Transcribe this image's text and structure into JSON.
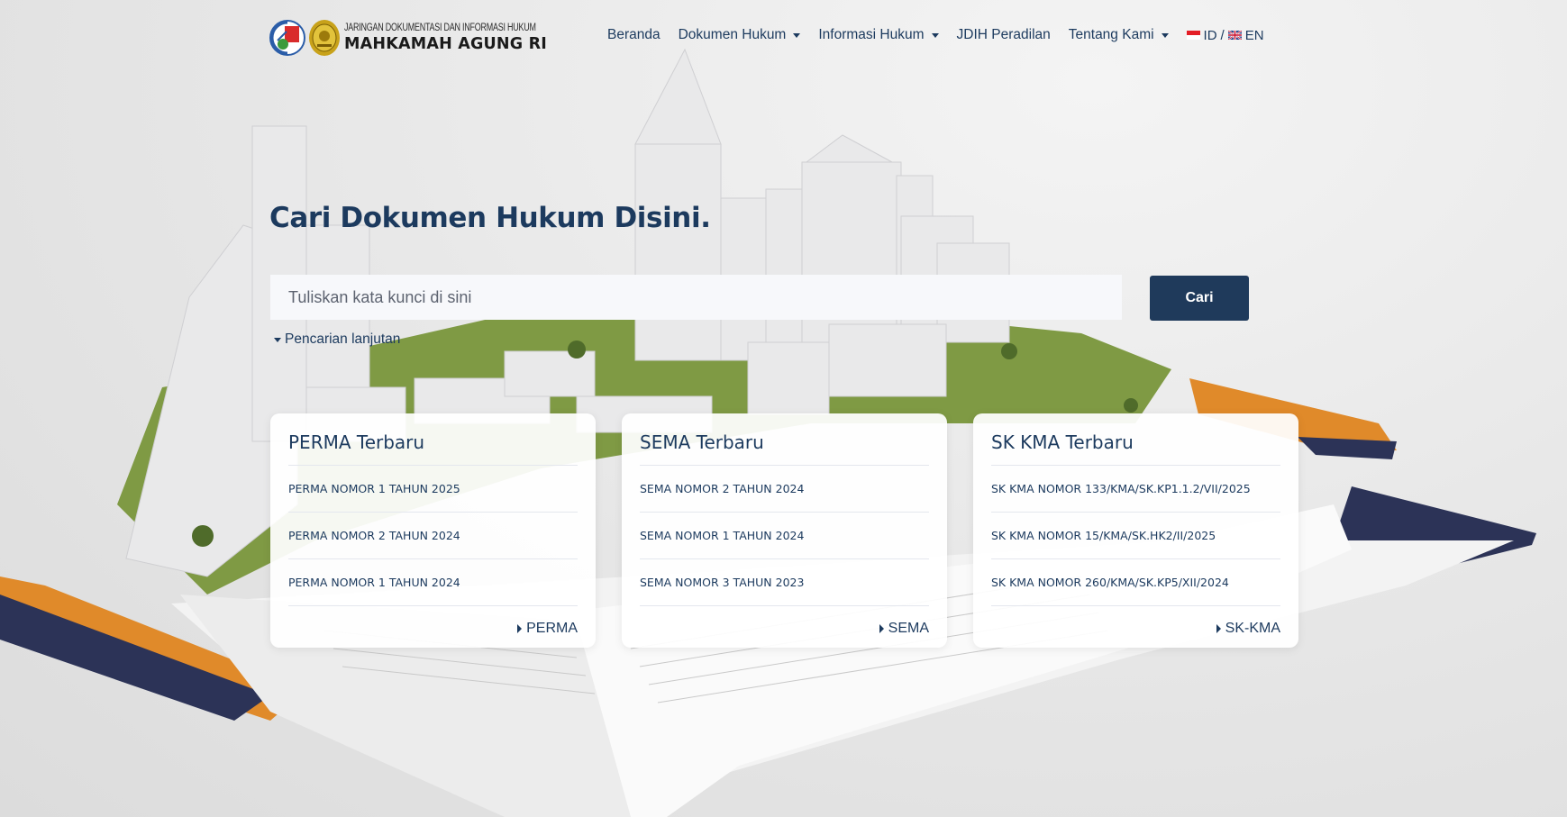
{
  "logo": {
    "line1": "JARINGAN DOKUMENTASI DAN INFORMASI HUKUM",
    "line2": "MAHKAMAH AGUNG RI"
  },
  "nav": {
    "items": [
      {
        "label": "Beranda",
        "dropdown": false
      },
      {
        "label": "Dokumen Hukum",
        "dropdown": true
      },
      {
        "label": "Informasi Hukum",
        "dropdown": true
      },
      {
        "label": "JDIH Peradilan",
        "dropdown": false
      },
      {
        "label": "Tentang Kami",
        "dropdown": true
      }
    ],
    "lang_id": "ID",
    "lang_sep": "/",
    "lang_en": "EN"
  },
  "hero": {
    "title": "Cari Dokumen Hukum Disini."
  },
  "search": {
    "placeholder": "Tuliskan kata kunci di sini",
    "value": "",
    "button_label": "Cari",
    "advanced_label": "Pencarian lanjutan"
  },
  "cards": [
    {
      "title": "PERMA Terbaru",
      "items": [
        "PERMA NOMOR 1 TAHUN 2025",
        "PERMA NOMOR 2 TAHUN 2024",
        "PERMA NOMOR 1 TAHUN 2024"
      ],
      "more_label": "PERMA"
    },
    {
      "title": "SEMA Terbaru",
      "items": [
        "SEMA NOMOR 2 TAHUN 2024",
        "SEMA NOMOR 1 TAHUN 2024",
        "SEMA NOMOR 3 TAHUN 2023"
      ],
      "more_label": "SEMA"
    },
    {
      "title": "SK KMA Terbaru",
      "items": [
        "SK KMA NOMOR 133/KMA/SK.KP1.1.2/VII/2025",
        "SK KMA NOMOR 15/KMA/SK.HK2/II/2025",
        "SK KMA NOMOR 260/KMA/SK.KP5/XII/2024"
      ],
      "more_label": "SK-KMA"
    }
  ],
  "colors": {
    "primary": "#1f3a5b",
    "text": "#1c3a5e",
    "book_orange": "#e08a2a",
    "book_navy": "#2c3357",
    "grass": "#7f9a44"
  }
}
